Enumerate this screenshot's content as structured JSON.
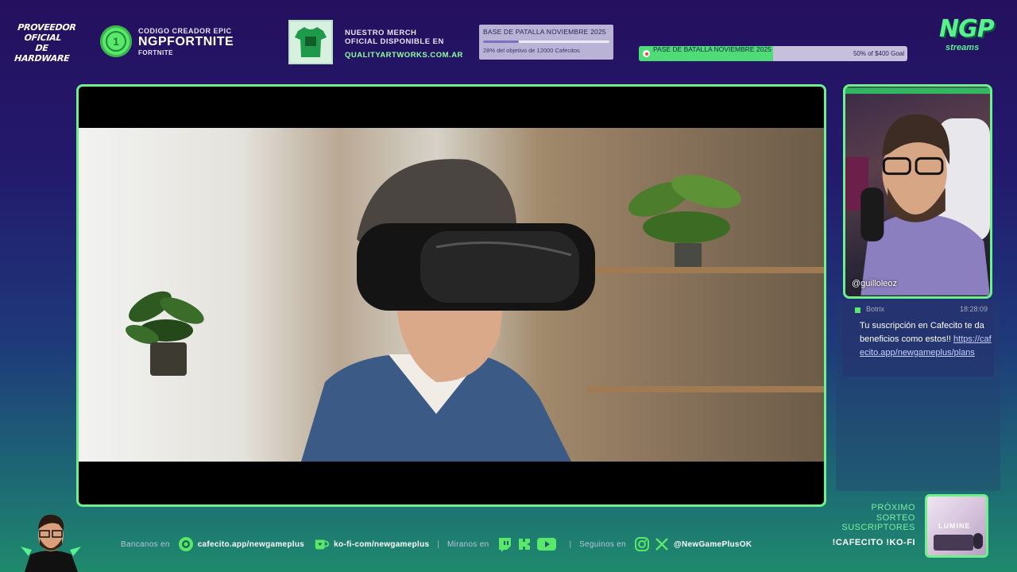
{
  "hardware_badge": {
    "line1": "PROVEEDOR",
    "line2": "OFICIAL DE",
    "line3": "HARDWARE"
  },
  "epic": {
    "small": "CODIGO CREADOR EPIC",
    "code": "NGPFORTNITE",
    "sub": "FORTNITE"
  },
  "merch": {
    "line1": "NUESTRO MERCH",
    "line2": "OFICIAL DISPONIBLE EN",
    "url": "QUALITYARTWORKS.COM.AR"
  },
  "goal_top": {
    "title": "BASE DE PATALLA NOVIEMBRE 2025",
    "text": "28% del objetivo de 12000 Cafecitos",
    "progress": 0.28
  },
  "goal_right": {
    "title": "PASE DE BATALLA NOVIEMBRE 2025",
    "text": "50% of $400 Goal",
    "progress": 0.5
  },
  "brand": {
    "main": "NGP",
    "sub": "streams"
  },
  "cam": {
    "name": "@guilloleoz"
  },
  "chat": {
    "user": "Botrix",
    "time": "18:28:09",
    "message": "Tu suscripción en Cafecito te da beneficios como estos!!",
    "link": "https://cafecito.app/newgameplus/plans"
  },
  "bottom": {
    "bancanos": "Bancanos en",
    "cafecito": "cafecito.app/newgameplus",
    "kofi": "ko-fi-com/newgameplus",
    "miranos": "Miranos en",
    "seguinos": "Seguinos en",
    "handle": "@NewGamePlusOK",
    "sep": "|"
  },
  "sorteo": {
    "line1": "PRÓXIMO",
    "line2": "SORTEO",
    "line3": "SUSCRIPTORES",
    "cmd": "!CAFECITO !KO-FI"
  },
  "prize": {
    "word": "LUMINE"
  },
  "colors": {
    "accent": "#6ef08a",
    "brand_green": "#5af08e",
    "bg_top": "#24105e",
    "bg_bottom": "#1f8a6c"
  },
  "icons": [
    "cafecito-icon",
    "kofi-cup-icon",
    "twitch-icon",
    "kick-icon",
    "youtube-icon",
    "instagram-icon",
    "x-icon"
  ]
}
